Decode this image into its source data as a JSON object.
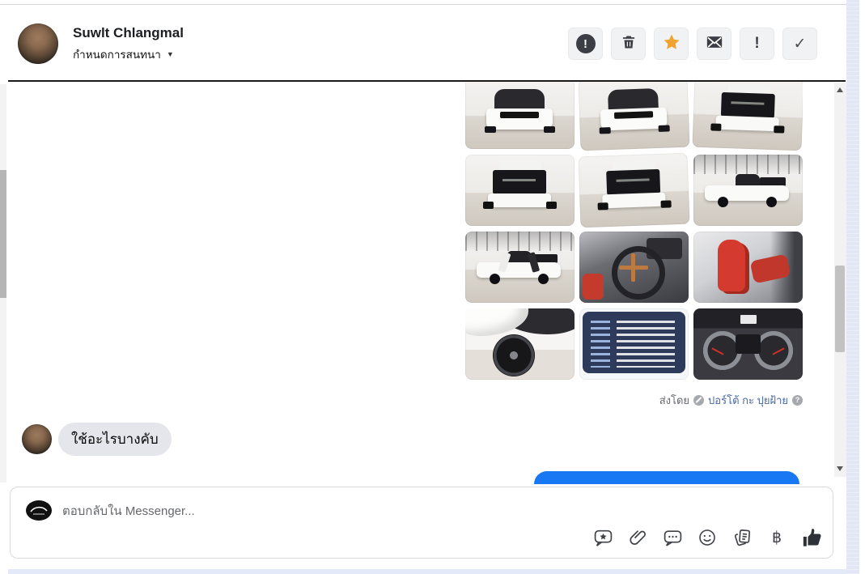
{
  "header": {
    "name": "Suwlt Chlangmal",
    "subtitle": "กำหนดการสนทนา",
    "caret": "▼",
    "actions": [
      {
        "icon": "circle-exclamation-icon",
        "glyph": "!"
      },
      {
        "icon": "trash-icon"
      },
      {
        "icon": "star-icon"
      },
      {
        "icon": "mail-icon"
      },
      {
        "icon": "exclamation-icon",
        "glyph": "!"
      },
      {
        "icon": "check-icon",
        "glyph": "✓"
      }
    ]
  },
  "chat": {
    "photo_views": [
      "truck-front-view",
      "truck-front-quarter-view",
      "truck-rear-quarter-view",
      "truck-rear-view",
      "truck-rear-quarter-view-2",
      "truck-side-view",
      "truck-side-doors-open",
      "interior-steering-wheel",
      "interior-racing-seats",
      "front-wheel-closeup",
      "vehicle-spec-sheet",
      "dashboard-gauges"
    ],
    "attribution": {
      "prefix": "ส่งโดย",
      "page_name": "ปอร์โต้ กะ ปุยฝ้าย",
      "help_glyph": "?"
    },
    "incoming_message": "ใช้อะไรบางคับ"
  },
  "composer": {
    "placeholder": "ตอบกลับใน Messenger...",
    "baht": "฿"
  },
  "colors": {
    "accent_blue": "#1877f2",
    "star_orange": "#f0a32f",
    "link_blue": "#4a67a5",
    "bubble_gray": "#e4e6eb"
  }
}
